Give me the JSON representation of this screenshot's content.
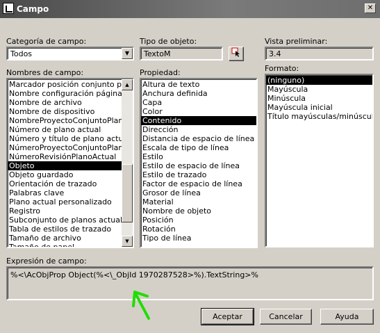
{
  "window": {
    "title": "Campo",
    "close_glyph": "✕"
  },
  "categoria": {
    "label": "Categoría de campo:",
    "value": "Todos"
  },
  "tipo_objeto": {
    "label": "Tipo de objeto:",
    "value": "TextoM"
  },
  "vista": {
    "label": "Vista preliminar:",
    "value": "3.4"
  },
  "nombres": {
    "label": "Nombres de campo:",
    "items": [
      "Marcador posición conjunto planos",
      "Nombre configuración página",
      "Nombre de archivo",
      "Nombre de dispositivo",
      "NombreProyectoConjuntoPlanosAc",
      "Número de plano actual",
      "Número y título de plano actual",
      "NúmeroProyectoConjuntoPlanosAc",
      "NúmeroRevisiónPlanoActual",
      "Objeto",
      "Objeto guardado",
      "Orientación de trazado",
      "Palabras clave",
      "Plano actual personalizado",
      "Registro",
      "Subconjunto de planos actual",
      "Tabla de estilos de trazado",
      "Tamaño de archivo",
      "Tamaño de papel"
    ],
    "selected": "Objeto"
  },
  "propiedad": {
    "label": "Propiedad:",
    "items": [
      "Altura de texto",
      "Anchura definida",
      "Capa",
      "Color",
      "Contenido",
      "Dirección",
      "Distancia de espacio de línea",
      "Escala de tipo de línea",
      "Estilo",
      "Estilo de espacio de línea",
      "Estilo de trazado",
      "Factor de espacio de línea",
      "Grosor de línea",
      "Material",
      "Nombre de objeto",
      "Posición",
      "Rotación",
      "Tipo de línea"
    ],
    "selected": "Contenido"
  },
  "formato": {
    "label": "Formato:",
    "items": [
      "(ninguno)",
      "Mayúscula",
      "Minúscula",
      "Mayúscula inicial",
      "Título mayúsculas/minúsculas"
    ],
    "selected": "(ninguno)"
  },
  "expresion": {
    "label": "Expresión de campo:",
    "value": "%<\\AcObjProp Object(%<\\_ObjId 1970287528>%).TextString>%"
  },
  "buttons": {
    "aceptar": "Aceptar",
    "cancelar": "Cancelar",
    "ayuda": "Ayuda"
  },
  "colors": {
    "title_bar": "#5a5a5a",
    "dialog_bg": "#d4d0c8",
    "selection": "#000000",
    "annotation_arrow": "#22dd00"
  }
}
